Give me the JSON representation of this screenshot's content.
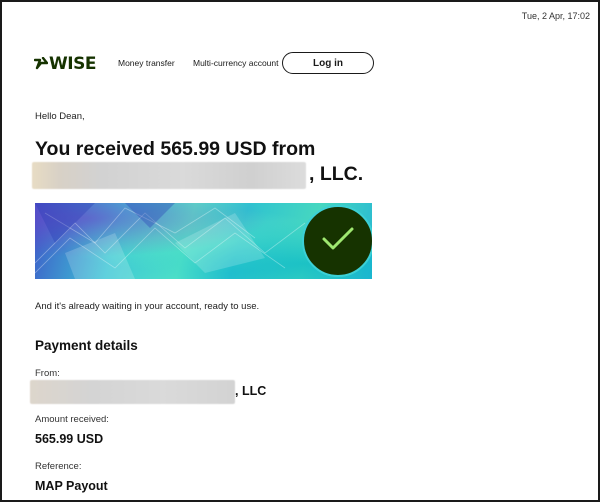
{
  "timestamp": "Tue, 2 Apr, 17:02",
  "header": {
    "logo_text": "WISE",
    "nav": {
      "money_transfer": "Money transfer",
      "multi_currency": "Multi-currency account"
    },
    "login_label": "Log in"
  },
  "email": {
    "greeting": "Hello Dean,",
    "headline_line1": "You received 565.99 USD from",
    "headline_suffix": ", LLC.",
    "waiting_text": "And it's already waiting in your account, ready to use."
  },
  "payment_details": {
    "title": "Payment details",
    "from_label": "From:",
    "from_suffix": ", LLC",
    "amount_label": "Amount received:",
    "amount_value": "565.99 USD",
    "reference_label": "Reference:",
    "reference_value": "MAP Payout"
  },
  "colors": {
    "brand_dark_green": "#163300",
    "check_green": "#9fe870",
    "banner_teal": "#3cc6d6"
  },
  "icons": {
    "logo": "wise-flag-icon",
    "banner_check": "checkmark-icon"
  }
}
